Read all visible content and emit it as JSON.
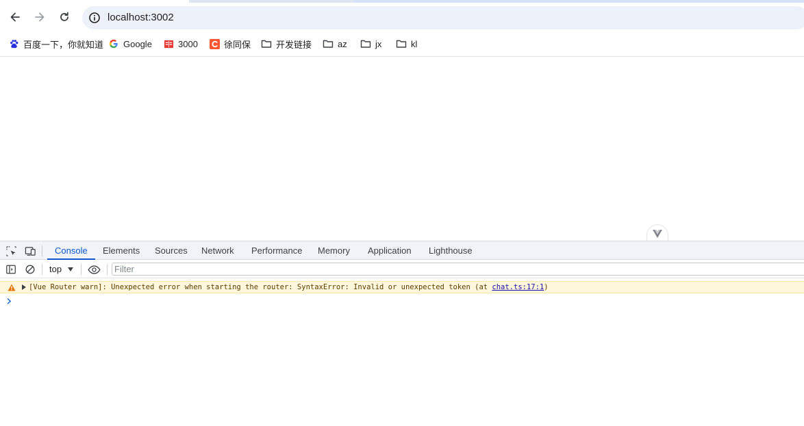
{
  "browser": {
    "address": {
      "url": "localhost:3002"
    },
    "bookmarks": [
      {
        "label": "百度一下，你就知道",
        "icon": "baidu-paw-icon"
      },
      {
        "label": "Google",
        "icon": "google-g-icon"
      },
      {
        "label": "3000",
        "icon": "red-book-icon"
      },
      {
        "label": "徐同保",
        "icon": "csdn-c-icon"
      },
      {
        "label": "开发链接",
        "icon": "folder-icon"
      },
      {
        "label": "az",
        "icon": "folder-icon"
      },
      {
        "label": "jx",
        "icon": "folder-icon"
      },
      {
        "label": "kl",
        "icon": "folder-icon"
      }
    ]
  },
  "devtools": {
    "tabs": [
      {
        "label": "Console",
        "active": true
      },
      {
        "label": "Elements"
      },
      {
        "label": "Sources"
      },
      {
        "label": "Network"
      },
      {
        "label": "Performance"
      },
      {
        "label": "Memory"
      },
      {
        "label": "Application"
      },
      {
        "label": "Lighthouse"
      }
    ],
    "console_toolbar": {
      "context": "top",
      "filter_placeholder": "Filter"
    },
    "messages": [
      {
        "level": "warning",
        "text": "[Vue Router warn]: Unexpected error when starting the router: SyntaxError: Invalid or unexpected token (at ",
        "link": "chat.ts:17:1",
        "suffix": ")"
      }
    ]
  },
  "colors": {
    "accent": "#0b57d0",
    "warning_bg": "#fef7dc",
    "warning_icon": "#e37400",
    "csdn": "#fc5531",
    "baidu": "#2932e1"
  }
}
